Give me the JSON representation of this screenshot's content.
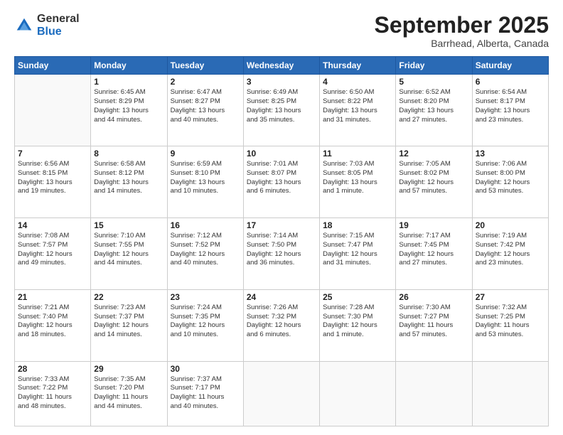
{
  "header": {
    "logo": {
      "general": "General",
      "blue": "Blue"
    },
    "title": "September 2025",
    "location": "Barrhead, Alberta, Canada"
  },
  "calendar": {
    "weekdays": [
      "Sunday",
      "Monday",
      "Tuesday",
      "Wednesday",
      "Thursday",
      "Friday",
      "Saturday"
    ],
    "weeks": [
      [
        {
          "day": null,
          "info": null
        },
        {
          "day": "1",
          "info": "Sunrise: 6:45 AM\nSunset: 8:29 PM\nDaylight: 13 hours\nand 44 minutes."
        },
        {
          "day": "2",
          "info": "Sunrise: 6:47 AM\nSunset: 8:27 PM\nDaylight: 13 hours\nand 40 minutes."
        },
        {
          "day": "3",
          "info": "Sunrise: 6:49 AM\nSunset: 8:25 PM\nDaylight: 13 hours\nand 35 minutes."
        },
        {
          "day": "4",
          "info": "Sunrise: 6:50 AM\nSunset: 8:22 PM\nDaylight: 13 hours\nand 31 minutes."
        },
        {
          "day": "5",
          "info": "Sunrise: 6:52 AM\nSunset: 8:20 PM\nDaylight: 13 hours\nand 27 minutes."
        },
        {
          "day": "6",
          "info": "Sunrise: 6:54 AM\nSunset: 8:17 PM\nDaylight: 13 hours\nand 23 minutes."
        }
      ],
      [
        {
          "day": "7",
          "info": "Sunrise: 6:56 AM\nSunset: 8:15 PM\nDaylight: 13 hours\nand 19 minutes."
        },
        {
          "day": "8",
          "info": "Sunrise: 6:58 AM\nSunset: 8:12 PM\nDaylight: 13 hours\nand 14 minutes."
        },
        {
          "day": "9",
          "info": "Sunrise: 6:59 AM\nSunset: 8:10 PM\nDaylight: 13 hours\nand 10 minutes."
        },
        {
          "day": "10",
          "info": "Sunrise: 7:01 AM\nSunset: 8:07 PM\nDaylight: 13 hours\nand 6 minutes."
        },
        {
          "day": "11",
          "info": "Sunrise: 7:03 AM\nSunset: 8:05 PM\nDaylight: 13 hours\nand 1 minute."
        },
        {
          "day": "12",
          "info": "Sunrise: 7:05 AM\nSunset: 8:02 PM\nDaylight: 12 hours\nand 57 minutes."
        },
        {
          "day": "13",
          "info": "Sunrise: 7:06 AM\nSunset: 8:00 PM\nDaylight: 12 hours\nand 53 minutes."
        }
      ],
      [
        {
          "day": "14",
          "info": "Sunrise: 7:08 AM\nSunset: 7:57 PM\nDaylight: 12 hours\nand 49 minutes."
        },
        {
          "day": "15",
          "info": "Sunrise: 7:10 AM\nSunset: 7:55 PM\nDaylight: 12 hours\nand 44 minutes."
        },
        {
          "day": "16",
          "info": "Sunrise: 7:12 AM\nSunset: 7:52 PM\nDaylight: 12 hours\nand 40 minutes."
        },
        {
          "day": "17",
          "info": "Sunrise: 7:14 AM\nSunset: 7:50 PM\nDaylight: 12 hours\nand 36 minutes."
        },
        {
          "day": "18",
          "info": "Sunrise: 7:15 AM\nSunset: 7:47 PM\nDaylight: 12 hours\nand 31 minutes."
        },
        {
          "day": "19",
          "info": "Sunrise: 7:17 AM\nSunset: 7:45 PM\nDaylight: 12 hours\nand 27 minutes."
        },
        {
          "day": "20",
          "info": "Sunrise: 7:19 AM\nSunset: 7:42 PM\nDaylight: 12 hours\nand 23 minutes."
        }
      ],
      [
        {
          "day": "21",
          "info": "Sunrise: 7:21 AM\nSunset: 7:40 PM\nDaylight: 12 hours\nand 18 minutes."
        },
        {
          "day": "22",
          "info": "Sunrise: 7:23 AM\nSunset: 7:37 PM\nDaylight: 12 hours\nand 14 minutes."
        },
        {
          "day": "23",
          "info": "Sunrise: 7:24 AM\nSunset: 7:35 PM\nDaylight: 12 hours\nand 10 minutes."
        },
        {
          "day": "24",
          "info": "Sunrise: 7:26 AM\nSunset: 7:32 PM\nDaylight: 12 hours\nand 6 minutes."
        },
        {
          "day": "25",
          "info": "Sunrise: 7:28 AM\nSunset: 7:30 PM\nDaylight: 12 hours\nand 1 minute."
        },
        {
          "day": "26",
          "info": "Sunrise: 7:30 AM\nSunset: 7:27 PM\nDaylight: 11 hours\nand 57 minutes."
        },
        {
          "day": "27",
          "info": "Sunrise: 7:32 AM\nSunset: 7:25 PM\nDaylight: 11 hours\nand 53 minutes."
        }
      ],
      [
        {
          "day": "28",
          "info": "Sunrise: 7:33 AM\nSunset: 7:22 PM\nDaylight: 11 hours\nand 48 minutes."
        },
        {
          "day": "29",
          "info": "Sunrise: 7:35 AM\nSunset: 7:20 PM\nDaylight: 11 hours\nand 44 minutes."
        },
        {
          "day": "30",
          "info": "Sunrise: 7:37 AM\nSunset: 7:17 PM\nDaylight: 11 hours\nand 40 minutes."
        },
        {
          "day": null,
          "info": null
        },
        {
          "day": null,
          "info": null
        },
        {
          "day": null,
          "info": null
        },
        {
          "day": null,
          "info": null
        }
      ]
    ]
  }
}
